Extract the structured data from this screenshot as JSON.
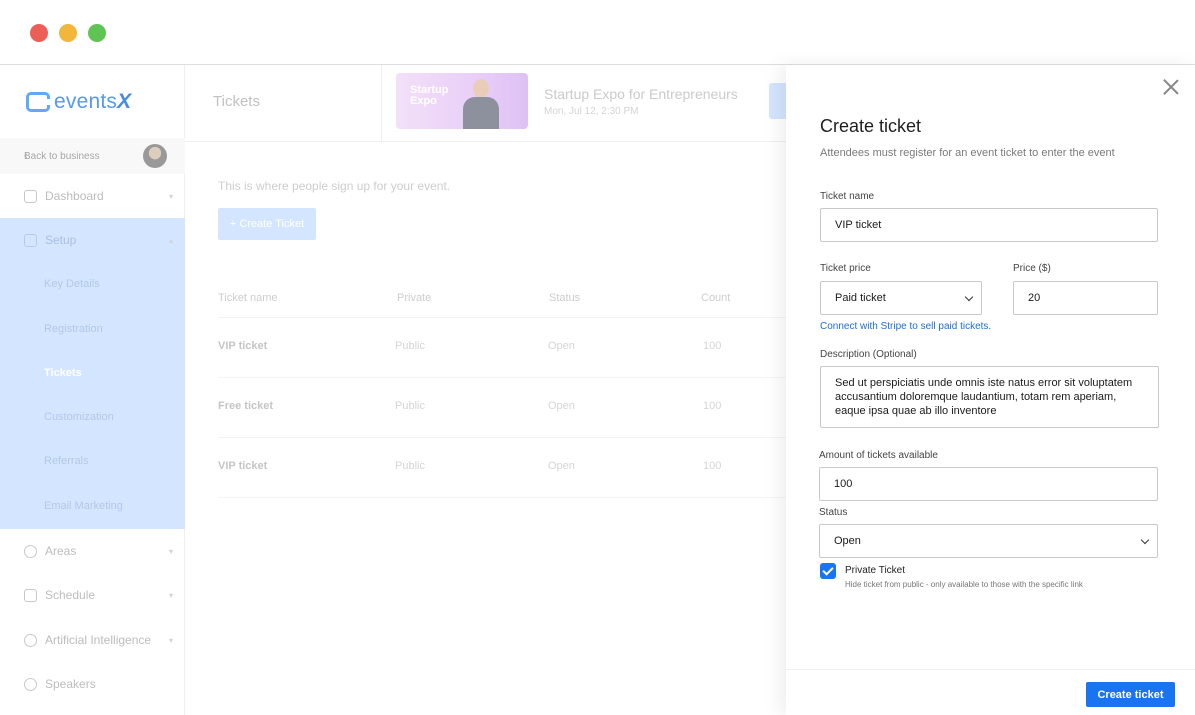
{
  "sidebar": {
    "logo_text": "events",
    "logo_x": "X",
    "back_label": "Back to business",
    "items": [
      {
        "label": "Dashboard"
      },
      {
        "label": "Setup"
      },
      {
        "label": "Areas"
      },
      {
        "label": "Schedule"
      },
      {
        "label": "Artificial Intelligence"
      },
      {
        "label": "Speakers"
      }
    ],
    "setup_subitems": [
      "Key Details",
      "Registration",
      "Tickets",
      "Customization",
      "Referrals",
      "Email Marketing"
    ]
  },
  "main": {
    "page_title": "Tickets",
    "event": {
      "thumb_text_line1": "Startup",
      "thumb_text_line2": "Expo",
      "title": "Startup Expo for Entrepreneurs",
      "date": "Mon, Jul 12, 2:30 PM"
    },
    "intro": "This is where people sign up for your event.",
    "create_button": "+ Create Ticket",
    "table": {
      "headers": [
        "Ticket name",
        "Private",
        "Status",
        "Count"
      ],
      "rows": [
        [
          "VIP ticket",
          "Public",
          "Open",
          "100"
        ],
        [
          "Free ticket",
          "Public",
          "Open",
          "100"
        ],
        [
          "VIP ticket",
          "Public",
          "Open",
          "100"
        ]
      ]
    }
  },
  "drawer": {
    "title": "Create ticket",
    "subtitle": "Attendees must register for an event ticket to enter the event",
    "ticket_name_label": "Ticket name",
    "ticket_name_value": "VIP ticket",
    "ticket_price_label": "Ticket price",
    "ticket_price_value": "Paid ticket",
    "price_label": "Price ($)",
    "price_value": "20",
    "stripe_link": "Connect with Stripe to sell paid tickets.",
    "description_label": "Description (Optional)",
    "description_value": "Sed ut perspiciatis unde omnis iste natus error sit voluptatem accusantium doloremque laudantium, totam rem aperiam, eaque ipsa quae ab illo inventore",
    "amount_label": "Amount of tickets available",
    "amount_value": "100",
    "status_label": "Status",
    "status_value": "Open",
    "private_title": "Private Ticket",
    "private_desc": "Hide ticket from public - only available to those with the specific link",
    "submit_label": "Create ticket"
  },
  "colors": {
    "accent": "#1874f0",
    "sidebar_active": "#cfe3ff"
  }
}
